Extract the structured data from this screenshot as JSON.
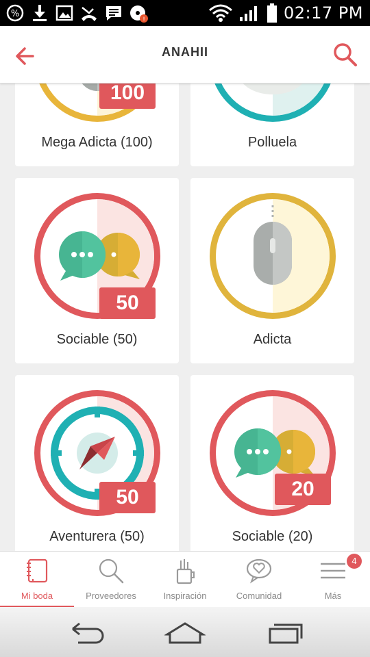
{
  "status_bar": {
    "time": "02:17 PM",
    "notification_badge": "!",
    "icons_left": [
      "percent-icon",
      "download-icon",
      "image-icon",
      "missed-call-icon",
      "message-icon",
      "music-icon"
    ],
    "icons_right": [
      "wifi-icon",
      "signal-icon",
      "battery-icon"
    ]
  },
  "app_bar": {
    "title": "ANAHII"
  },
  "badges": [
    {
      "label": "Mega Adicta (100)",
      "number": "100",
      "ring_color": "#e8b53a",
      "icon": "mouse-icon"
    },
    {
      "label": "Polluela",
      "number": "",
      "ring_color": "#1fb0b3",
      "icon": "chick-icon"
    },
    {
      "label": "Sociable (50)",
      "number": "50",
      "ring_color": "#e0585c",
      "icon": "chat-bubbles-icon"
    },
    {
      "label": "Adicta",
      "number": "",
      "ring_color": "#e8b53a",
      "icon": "mouse-icon"
    },
    {
      "label": "Aventurera (50)",
      "number": "50",
      "ring_color": "#e0585c",
      "icon": "compass-icon"
    },
    {
      "label": "Sociable (20)",
      "number": "20",
      "ring_color": "#e0585c",
      "icon": "chat-bubbles-icon"
    }
  ],
  "bottom_nav": {
    "items": [
      {
        "label": "Mi boda",
        "icon": "notebook-icon",
        "active": true
      },
      {
        "label": "Proveedores",
        "icon": "search-icon",
        "active": false
      },
      {
        "label": "Inspiración",
        "icon": "tools-cup-icon",
        "active": false
      },
      {
        "label": "Comunidad",
        "icon": "heart-chat-icon",
        "active": false
      },
      {
        "label": "Más",
        "icon": "menu-icon",
        "active": false
      }
    ],
    "more_badge": "4"
  },
  "colors": {
    "accent": "#e0585c",
    "teal": "#1fb0b3",
    "gold": "#e8b53a",
    "green": "#4fbf9f"
  }
}
